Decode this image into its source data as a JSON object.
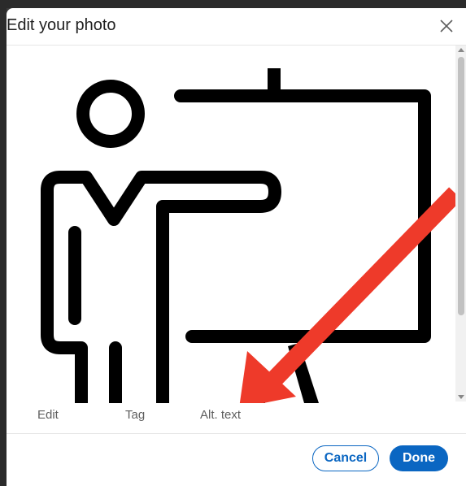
{
  "modal": {
    "title": "Edit your photo",
    "close_icon": "close-icon"
  },
  "image": {
    "description_icon": "presenter-whiteboard-icon",
    "annotation": "red-arrow"
  },
  "tabs": [
    {
      "label": "Edit"
    },
    {
      "label": "Tag"
    },
    {
      "label": "Alt. text"
    }
  ],
  "footer": {
    "cancel_label": "Cancel",
    "done_label": "Done"
  },
  "colors": {
    "accent": "#0a66c2",
    "arrow": "#ee3a2a"
  }
}
